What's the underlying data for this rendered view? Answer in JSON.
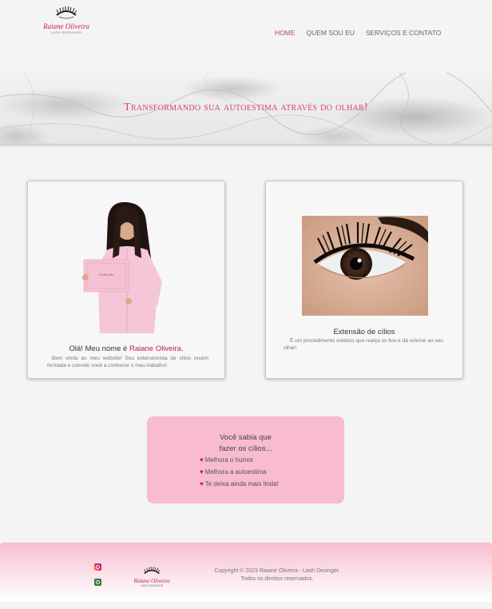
{
  "brand": {
    "name": "Raiane Oliveira",
    "subtitle": "LASH DESIGNER",
    "accent_color": "#c2185b",
    "pink_bg": "#f8bbd0"
  },
  "nav": {
    "items": [
      {
        "label": "HOME",
        "active": true
      },
      {
        "label": "QUEM SOU EU",
        "active": false
      },
      {
        "label": "SERVIÇOS E CONTATO",
        "active": false
      }
    ]
  },
  "banner": {
    "tagline": "Transformando sua autoestima através do olhar!"
  },
  "intro_card": {
    "greeting": "Olá! Meu nome é ",
    "name": "Raiane Oliveira.",
    "text": "Bem vinda ao meu website! Sou extensionista de cílios recém formada e convido você a conhecer o meu trabalho!",
    "certificate_text": "Certificado"
  },
  "service_card": {
    "title": "Extensão de cílios",
    "text": "É um procedimento estético que realça os fios e dá volume ao seu olhar!"
  },
  "info_box": {
    "title_line1": "Você sabia que",
    "title_line2": "fazer os cílios...",
    "items": [
      "Melhora o humor",
      "Melhora a autoestima",
      "Te deixa ainda mais linda!"
    ],
    "bullet_icon": "heart-icon"
  },
  "footer": {
    "social": [
      "instagram-icon",
      "whatsapp-icon"
    ],
    "copyright_line1": "Copyright © 2023 Raiane Oliveira - Lash Desinger.",
    "copyright_line2": "Todos os direitos reservados."
  }
}
